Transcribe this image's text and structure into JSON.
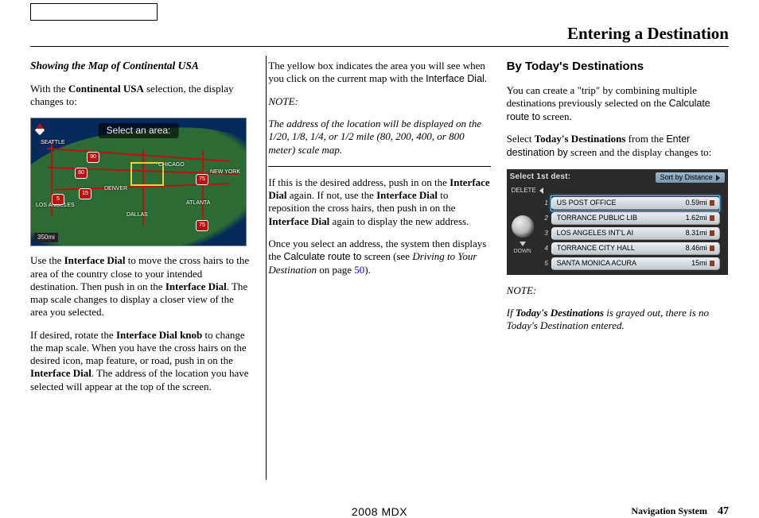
{
  "header": {
    "title": "Entering a Destination"
  },
  "col1": {
    "heading": "Showing the Map of Continental USA",
    "p1a": "With the ",
    "p1b": "Continental USA",
    "p1c": " selection, the display changes to:",
    "map": {
      "banner": "Select an area:",
      "scale": "350mi",
      "cities": {
        "seattle": "SEATTLE",
        "la": "LOS ANGELES",
        "denver": "DENVER",
        "dallas": "DALLAS",
        "chicago": "CHICAGO",
        "atlanta": "ATLANTA",
        "newyork": "NEW YORK"
      },
      "shields": {
        "i5": "5",
        "i80": "80",
        "i90": "90",
        "i15": "15",
        "i75a": "75",
        "i75b": "75"
      }
    },
    "p2a": "Use the ",
    "p2b": "Interface Dial",
    "p2c": " to move the cross hairs to the area of the country close to your intended destination. Then push in on the ",
    "p2d": "Interface Dial",
    "p2e": ". The map scale changes to display a closer view of the area you selected.",
    "p3a": "If desired, rotate the ",
    "p3b": "Interface Dial knob",
    "p3c": " to change the map scale. When you have the cross hairs on the desired icon, map feature, or road, push in on the ",
    "p3d": "Interface Dial",
    "p3e": ". The address of the location you have selected will appear at the top of the screen."
  },
  "col2": {
    "p1a": "The yellow box indicates the area you will see when you click on the current map with the ",
    "p1b": "Interface Dial",
    "p1c": ".",
    "note_heading": "NOTE:",
    "note_body": "The address of the location will be displayed on the 1/20, 1/8, 1/4, or 1/2 mile (80, 200, 400, or 800 meter) scale map.",
    "hr_width": "full",
    "p2a": "If this is the desired address, push in on the ",
    "p2b": "Interface Dial",
    "p2c": " again. If not, use the ",
    "p2d": "Interface Dial",
    "p2e": " to reposition the cross hairs, then push in on the ",
    "p2f": "Interface Dial",
    "p2g": " again to display the new address.",
    "p3a": "Once you select an address, the system then displays the ",
    "p3b_sans": "Calculate route to",
    "p3c": " screen (see ",
    "p3d_ital": "Driving to Your Destination",
    "p3e": " on page ",
    "p3f_link": "50",
    "p3g": ")."
  },
  "col3": {
    "heading": "By Today's Destinations",
    "p1a": "You can create a \"trip\" by combining multiple destinations previously selected on the ",
    "p1b_sans": "Calculate route to",
    "p1c": " screen.",
    "p2a": "Select ",
    "p2b": "Today's Destinations",
    "p2c": " from the ",
    "p2d_sans": "Enter destination by",
    "p2e": " screen and the display changes to:",
    "destfig": {
      "title": "Select 1st dest:",
      "sort": "Sort by Distance",
      "delete": "DELETE",
      "down": "DOWN",
      "rows": [
        {
          "n": "1",
          "name": "US POST OFFICE",
          "dist": "0.59mi"
        },
        {
          "n": "2",
          "name": "TORRANCE PUBLIC LIB",
          "dist": "1.62mi"
        },
        {
          "n": "3",
          "name": "LOS ANGELES INT'L AI",
          "dist": "8.31mi"
        },
        {
          "n": "4",
          "name": "TORRANCE CITY HALL",
          "dist": "8.46mi"
        },
        {
          "n": "5",
          "name": "SANTA MONICA ACURA",
          "dist": "15mi"
        }
      ]
    },
    "note_heading": "NOTE:",
    "note_a": "If ",
    "note_b": "Today's Destinations",
    "note_c": " is grayed out, there is no Today's Destination entered."
  },
  "footer": {
    "center": "2008 MDX",
    "right_label": "Navigation System",
    "page": "47"
  }
}
